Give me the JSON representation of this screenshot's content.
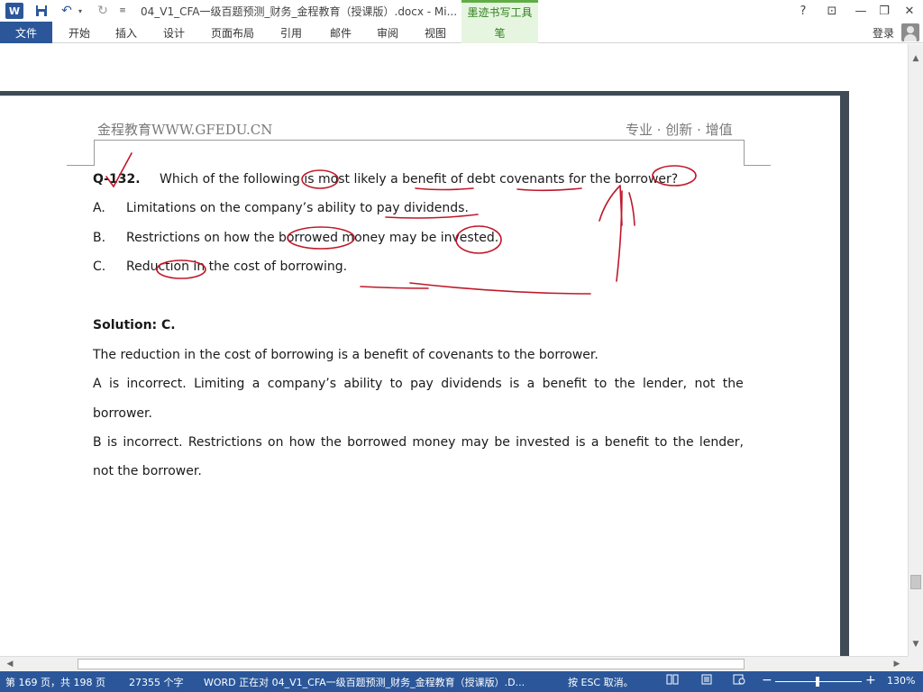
{
  "titlebar": {
    "app_icon": "word-logo",
    "app_letter": "W",
    "document_title": "04_V1_CFA一级百题预测_财务_金程教育（授课版）.docx - Mi...",
    "context_group": "墨迹书写工具",
    "quick_access": [
      "save-icon",
      "undo-icon",
      "redo-icon",
      "customize-icon"
    ],
    "window_controls": {
      "help": "?",
      "ribbon_display": "⊡",
      "minimize": "—",
      "restore": "❐",
      "close": "✕"
    }
  },
  "ribbon": {
    "file_tab": "文件",
    "tabs": [
      "开始",
      "插入",
      "设计",
      "页面布局",
      "引用",
      "邮件",
      "审阅",
      "视图"
    ],
    "context_tab": "笔",
    "signin": "登录"
  },
  "document": {
    "header_left": "金程教育WWW.GFEDU.CN",
    "header_right": "专业 · 创新 · 增值",
    "question": {
      "number": "Q-132.",
      "text": "Which of the following is most likely a benefit of debt covenants for the borrower?",
      "options": [
        {
          "letter": "A.",
          "text": "Limitations on the company’s ability to pay dividends."
        },
        {
          "letter": "B.",
          "text": "Restrictions on how the borrowed money may be invested."
        },
        {
          "letter": "C.",
          "text": "Reduction in the cost of borrowing."
        }
      ]
    },
    "solution": {
      "heading": "Solution: C.",
      "para1": "The reduction in the cost of borrowing is a benefit of covenants to the borrower.",
      "para2_line1": [
        "A",
        "is",
        "incorrect.",
        "Limiting",
        "a",
        "company’s",
        "ability",
        "to",
        "pay",
        "dividends",
        "is",
        "a",
        "benefit",
        "to",
        "the",
        "lender,",
        "not",
        "the"
      ],
      "para2_line2": "borrower.",
      "para3_line1": [
        "B",
        "is",
        "incorrect.",
        "Restrictions",
        "on",
        "how",
        "the",
        "borrowed",
        "money",
        "may",
        "be",
        "invested",
        "is",
        "a",
        "benefit",
        "to",
        "the",
        "lender,"
      ],
      "para3_line2": "not the borrower."
    },
    "ink_color": "#c0182a"
  },
  "statusbar": {
    "page": "第 169 页，共 198 页",
    "words": "27355 个字",
    "saving": "WORD 正在对 04_V1_CFA一级百题预测_财务_金程教育（授课版）.D...",
    "esc_hint": "按 ESC 取消。",
    "zoom_minus": "−",
    "zoom_plus": "+",
    "zoom_level": "130%",
    "color": "#2b579a"
  }
}
